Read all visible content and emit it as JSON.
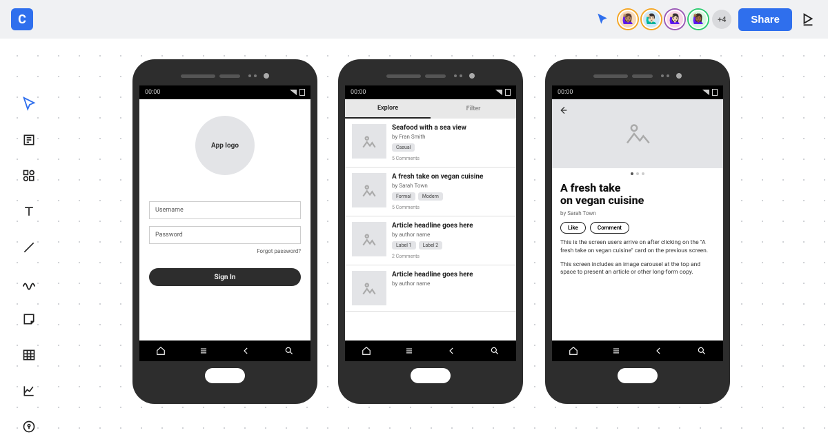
{
  "header": {
    "logo_letter": "C",
    "extra_avatars": "+4",
    "share_label": "Share"
  },
  "phone_common": {
    "time": "00:00"
  },
  "phone1": {
    "logo_text": "App logo",
    "username_placeholder": "Username",
    "password_placeholder": "Password",
    "forgot": "Forgot password?",
    "signin": "Sign In"
  },
  "phone2": {
    "tab1": "Explore",
    "tab2": "Filter",
    "cards": [
      {
        "title": "Seafood with a sea view",
        "byline": "by Fran Smith",
        "tags": [
          "Casual"
        ],
        "comments": "5 Comments"
      },
      {
        "title": "A fresh take on vegan cuisine",
        "byline": "by Sarah Town",
        "tags": [
          "Formal",
          "Modern"
        ],
        "comments": "5 Comments"
      },
      {
        "title": "Article headline goes here",
        "byline": "by author name",
        "tags": [
          "Label 1",
          "Label 2"
        ],
        "comments": "2 Comments"
      },
      {
        "title": "Article headline goes here",
        "byline": "by author name",
        "tags": [],
        "comments": ""
      }
    ]
  },
  "phone3": {
    "title": "A fresh take\non vegan cuisine",
    "byline": "by Sarah Town",
    "like": "Like",
    "comment": "Comment",
    "para1": "This is the screen users arrive on after clicking on the \"A fresh take on vegan cuisine\" card on the previous screen.",
    "para2": "This screen includes an image carousel at the top and space to present an article or other long-form copy."
  }
}
